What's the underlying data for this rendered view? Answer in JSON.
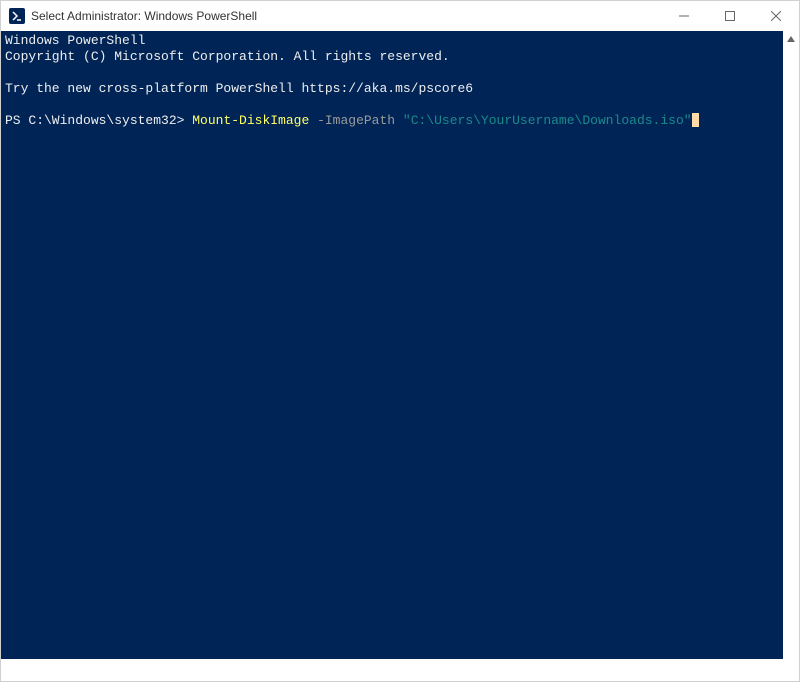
{
  "window": {
    "title": "Select Administrator: Windows PowerShell"
  },
  "terminal": {
    "line1": "Windows PowerShell",
    "line2": "Copyright (C) Microsoft Corporation. All rights reserved.",
    "line3": "",
    "line4": "Try the new cross-platform PowerShell https://aka.ms/pscore6",
    "line5": "",
    "prompt": "PS C:\\Windows\\system32> ",
    "cmd": "Mount-DiskImage",
    "space1": " ",
    "param": "-ImagePath",
    "space2": " ",
    "string": "\"C:\\Users\\YourUsername\\Downloads.iso\""
  },
  "colors": {
    "terminal_bg": "#012456",
    "cmd_yellow": "#ffff66",
    "param_gray": "#9a9a9a",
    "string_teal": "#1a8a8a"
  }
}
